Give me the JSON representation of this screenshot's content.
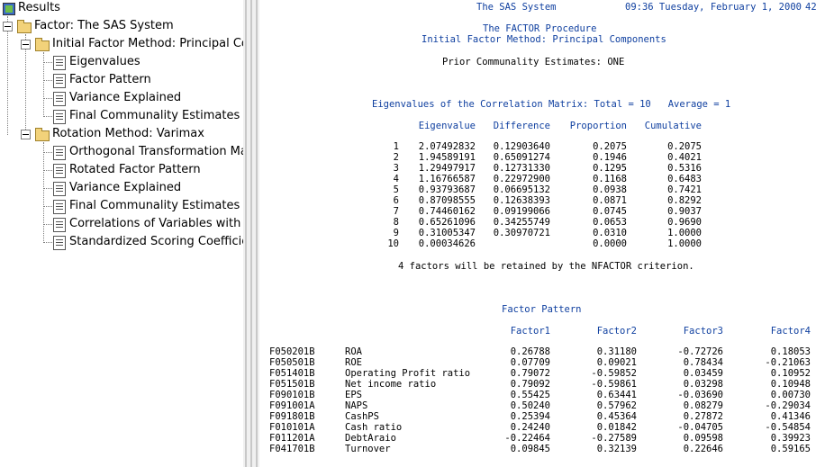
{
  "tree": {
    "root_label": "Results",
    "items": [
      {
        "label": "Factor:  The SAS System"
      },
      {
        "label": "Initial Factor Method: Principal Comp"
      },
      {
        "label": "Eigenvalues"
      },
      {
        "label": "Factor Pattern"
      },
      {
        "label": "Variance Explained"
      },
      {
        "label": "Final Communality Estimates"
      },
      {
        "label": "Rotation Method: Varimax"
      },
      {
        "label": "Orthogonal Transformation Matr"
      },
      {
        "label": "Rotated Factor Pattern"
      },
      {
        "label": "Variance Explained"
      },
      {
        "label": "Final Communality Estimates"
      },
      {
        "label": "Correlations of Variables with Fac"
      },
      {
        "label": "Standardized Scoring Coefficients"
      }
    ]
  },
  "output": {
    "header_title": "The SAS System",
    "header_time": "09:36 Tuesday, February 1, 2000",
    "page_number": "42",
    "procedure": "The FACTOR Procedure",
    "method": "Initial Factor Method: Principal Components",
    "prior": "Prior Communality Estimates: ONE",
    "eig_title": "Eigenvalues of the Correlation Matrix: Total = 10   Average = 1",
    "eig_headers": [
      "Eigenvalue",
      "Difference",
      "Proportion",
      "Cumulative"
    ],
    "eig_rows": [
      [
        "1",
        "2.07492832",
        "0.12903640",
        "0.2075",
        "0.2075"
      ],
      [
        "2",
        "1.94589191",
        "0.65091274",
        "0.1946",
        "0.4021"
      ],
      [
        "3",
        "1.29497917",
        "0.12731330",
        "0.1295",
        "0.5316"
      ],
      [
        "4",
        "1.16766587",
        "0.22972900",
        "0.1168",
        "0.6483"
      ],
      [
        "5",
        "0.93793687",
        "0.06695132",
        "0.0938",
        "0.7421"
      ],
      [
        "6",
        "0.87098555",
        "0.12638393",
        "0.0871",
        "0.8292"
      ],
      [
        "7",
        "0.74460162",
        "0.09199066",
        "0.0745",
        "0.9037"
      ],
      [
        "8",
        "0.65261096",
        "0.34255749",
        "0.0653",
        "0.9690"
      ],
      [
        "9",
        "0.31005347",
        "0.30970721",
        "0.0310",
        "1.0000"
      ],
      [
        "10",
        "0.00034626",
        "",
        "0.0000",
        "1.0000"
      ]
    ],
    "retained": "4 factors will be retained by the NFACTOR criterion.",
    "fp_title": "Factor Pattern",
    "fp_headers": [
      "Factor1",
      "Factor2",
      "Factor3",
      "Factor4"
    ],
    "fp_rows": [
      [
        "F050201B",
        "ROA",
        "0.26788",
        "0.31180",
        "-0.72726",
        "0.18053"
      ],
      [
        "F050501B",
        "ROE",
        "0.07709",
        "0.09021",
        "0.78434",
        "-0.21063"
      ],
      [
        "F051401B",
        "Operating Profit ratio",
        "0.79072",
        "-0.59852",
        "0.03459",
        "0.10952"
      ],
      [
        "F051501B",
        "Net income ratio",
        "0.79092",
        "-0.59861",
        "0.03298",
        "0.10948"
      ],
      [
        "F090101B",
        "EPS",
        "0.55425",
        "0.63441",
        "-0.03690",
        "0.00730"
      ],
      [
        "F091001A",
        "NAPS",
        "0.50240",
        "0.57962",
        "0.08279",
        "-0.29034"
      ],
      [
        "F091801B",
        "CashPS",
        "0.25394",
        "0.45364",
        "0.27872",
        "0.41346"
      ],
      [
        "F010101A",
        "Cash ratio",
        "0.24240",
        "0.01842",
        "-0.04705",
        "-0.54854"
      ],
      [
        "F011201A",
        "DebtAraio",
        "-0.22464",
        "-0.27589",
        "0.09598",
        "0.39923"
      ],
      [
        "F041701B",
        "Turnover",
        "0.09845",
        "0.32139",
        "0.22646",
        "0.59165"
      ]
    ]
  }
}
